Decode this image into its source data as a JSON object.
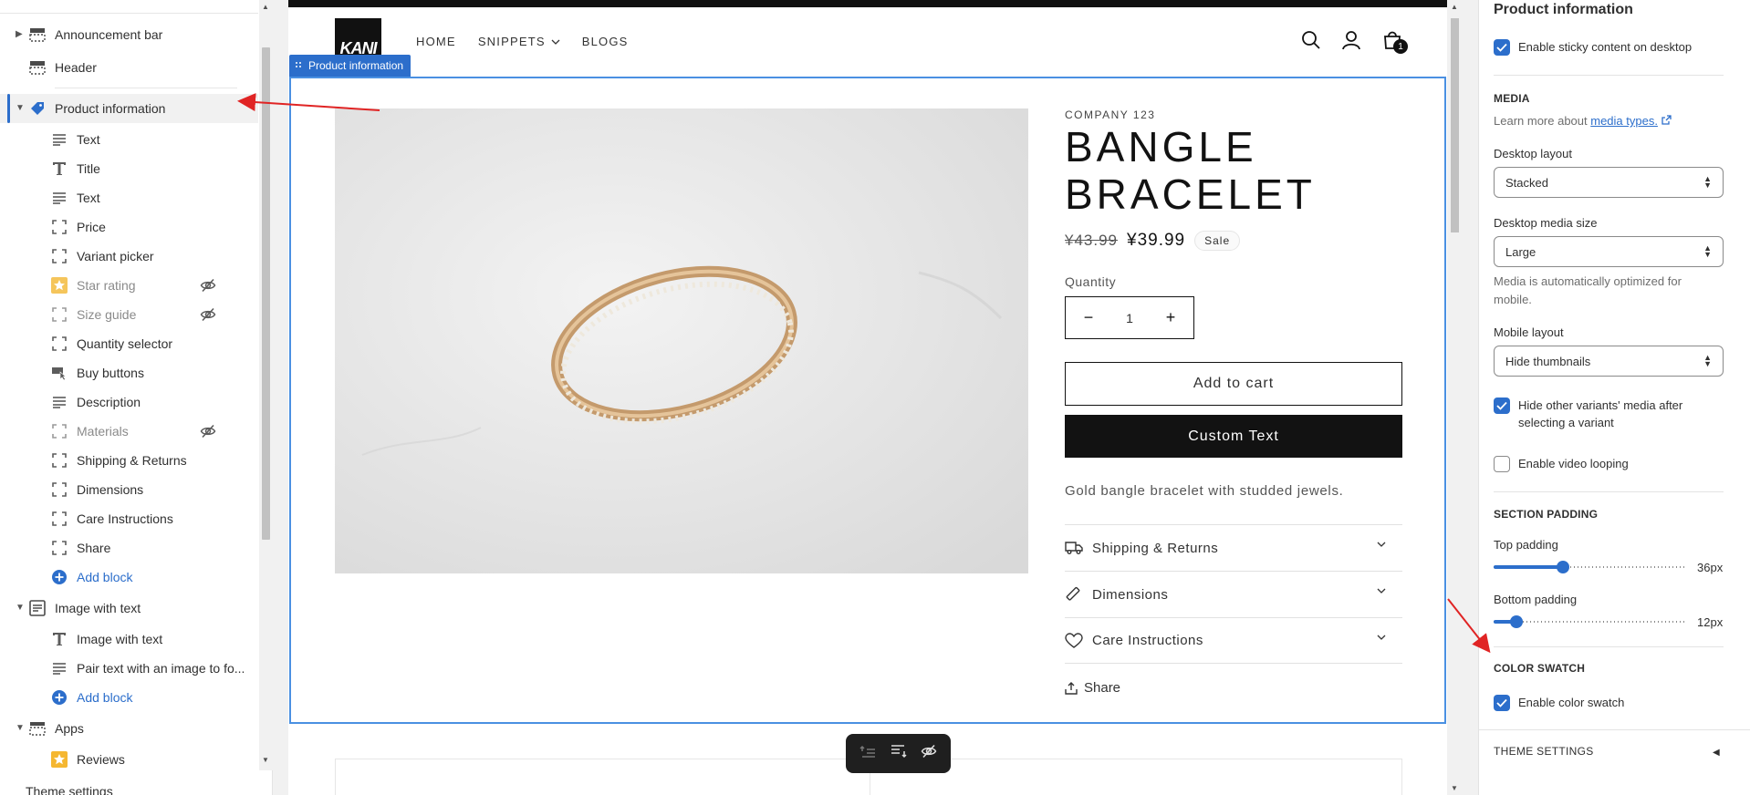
{
  "left_sidebar": {
    "items": [
      {
        "type": "section",
        "label": "Announcement bar",
        "icon": "announcement-bar-icon",
        "collapsed": true
      },
      {
        "type": "section",
        "label": "Header",
        "icon": "header-icon"
      },
      {
        "type": "section",
        "label": "Product information",
        "icon": "tag-icon",
        "selected": true,
        "expanded": true
      },
      {
        "type": "block",
        "label": "Text",
        "icon": "text-lines-icon"
      },
      {
        "type": "block",
        "label": "Title",
        "icon": "title-icon"
      },
      {
        "type": "block",
        "label": "Text",
        "icon": "text-lines-icon"
      },
      {
        "type": "block",
        "label": "Price",
        "icon": "block-frame-icon"
      },
      {
        "type": "block",
        "label": "Variant picker",
        "icon": "block-frame-icon"
      },
      {
        "type": "block",
        "label": "Star rating",
        "icon": "star-icon",
        "hidden": true
      },
      {
        "type": "block",
        "label": "Size guide",
        "icon": "block-frame-icon",
        "hidden": true
      },
      {
        "type": "block",
        "label": "Quantity selector",
        "icon": "block-frame-icon"
      },
      {
        "type": "block",
        "label": "Buy buttons",
        "icon": "buy-buttons-icon"
      },
      {
        "type": "block",
        "label": "Description",
        "icon": "text-lines-icon"
      },
      {
        "type": "block",
        "label": "Materials",
        "icon": "block-frame-icon",
        "hidden": true
      },
      {
        "type": "block",
        "label": "Shipping & Returns",
        "icon": "block-frame-icon"
      },
      {
        "type": "block",
        "label": "Dimensions",
        "icon": "block-frame-icon"
      },
      {
        "type": "block",
        "label": "Care Instructions",
        "icon": "block-frame-icon"
      },
      {
        "type": "block",
        "label": "Share",
        "icon": "block-frame-icon"
      },
      {
        "type": "add",
        "label": "Add block",
        "icon": "add-circle-icon"
      },
      {
        "type": "section",
        "label": "Image with text",
        "icon": "image-with-text-icon",
        "expanded": true
      },
      {
        "type": "block",
        "label": "Image with text",
        "icon": "title-icon"
      },
      {
        "type": "block",
        "label": "Pair text with an image to fo...",
        "icon": "text-lines-icon"
      },
      {
        "type": "add",
        "label": "Add block",
        "icon": "add-circle-icon"
      },
      {
        "type": "section",
        "label": "Apps",
        "icon": "apps-icon",
        "expanded": true
      },
      {
        "type": "block",
        "label": "Reviews",
        "icon": "star-icon"
      }
    ],
    "footer_label": "Theme settings"
  },
  "preview": {
    "logo_text": "KANI",
    "nav": [
      "HOME",
      "SNIPPETS",
      "BLOGS"
    ],
    "cart_count": "1",
    "selection_tag": "Product information",
    "product": {
      "vendor": "COMPANY 123",
      "title_line1": "BANGLE",
      "title_line2": "BRACELET",
      "old_price": "¥43.99",
      "new_price": "¥39.99",
      "sale_badge": "Sale",
      "quantity_label": "Quantity",
      "quantity_value": "1",
      "add_to_cart": "Add to cart",
      "custom_button": "Custom Text",
      "description": "Gold bangle bracelet with studded jewels.",
      "accordions": [
        "Shipping & Returns",
        "Dimensions",
        "Care Instructions"
      ],
      "share": "Share"
    }
  },
  "right_panel": {
    "title": "Product information",
    "sticky": {
      "label": "Enable sticky content on desktop",
      "checked": true
    },
    "media_heading": "MEDIA",
    "media_help_prefix": "Learn more about ",
    "media_help_link": "media types.",
    "desktop_layout": {
      "label": "Desktop layout",
      "value": "Stacked"
    },
    "desktop_media_size": {
      "label": "Desktop media size",
      "value": "Large"
    },
    "media_note": "Media is automatically optimized for mobile.",
    "mobile_layout": {
      "label": "Mobile layout",
      "value": "Hide thumbnails"
    },
    "hide_variants": {
      "label": "Hide other variants' media after selecting a variant",
      "checked": true
    },
    "video_loop": {
      "label": "Enable video looping",
      "checked": false
    },
    "padding_heading": "SECTION PADDING",
    "top_padding": {
      "label": "Top padding",
      "value": "36px",
      "fraction": 0.36
    },
    "bottom_padding": {
      "label": "Bottom padding",
      "value": "12px",
      "fraction": 0.12
    },
    "swatch_heading": "COLOR SWATCH",
    "color_swatch": {
      "label": "Enable color swatch",
      "checked": true
    },
    "theme_settings": "THEME SETTINGS"
  },
  "colors": {
    "accent": "#2c6ecb",
    "annotation": "#e02424",
    "button_dark": "#121212"
  }
}
